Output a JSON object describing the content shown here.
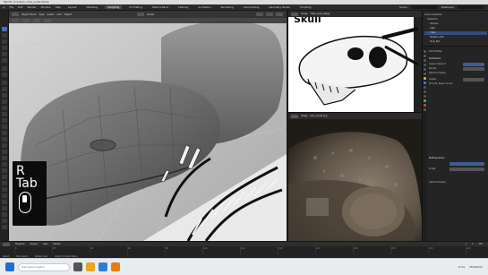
{
  "window": {
    "title": "Blender [C:\\Users\\…\\trex_sculpt.blend]"
  },
  "menubar": {
    "items": [
      "File",
      "Edit",
      "Render",
      "Window",
      "Help"
    ],
    "workspaces": [
      "Layout",
      "Modeling",
      "Sculpting",
      "UV Editing",
      "Texture Paint",
      "Shading",
      "Animation",
      "Rendering",
      "Compositing",
      "Geometry Nodes",
      "Scripting"
    ],
    "active_workspace": "Sculpting",
    "scene_label": "Scene",
    "view_layer_label": "ViewLayer"
  },
  "viewport": {
    "mode_label": "Object Mode",
    "menu": [
      "View",
      "Select",
      "Add",
      "Object"
    ],
    "shading_label": "Global"
  },
  "key_overlay": {
    "line1": "R",
    "line2": "Tab"
  },
  "image_viewer": {
    "header_label": "Image",
    "image_name": "T-Rex_skull_ref.jpg",
    "heading": "Skull"
  },
  "render_viewer": {
    "header_label": "Image",
    "image_name": "trex_render.png"
  },
  "outliner": {
    "rows": [
      "Scene Collection",
      "Collection",
      "Camera",
      "Light",
      "T-Rex",
      "Skeleton_Ref",
      "Skull_Ref"
    ],
    "selected_index": 4
  },
  "properties": {
    "tabs": [
      "tool",
      "render",
      "output",
      "view-layer",
      "scene",
      "world",
      "object",
      "modifiers",
      "particles",
      "physics",
      "constraints",
      "data",
      "material",
      "texture"
    ],
    "rows": [
      {
        "label": "Add Modifier",
        "value": ""
      },
      {
        "label": "Subdivision",
        "value": ""
      },
      {
        "label": "Levels Viewport",
        "value": "2"
      },
      {
        "label": "Render",
        "value": "2"
      },
      {
        "label": "Optimal Display",
        "value": ""
      },
      {
        "label": "Quality",
        "value": "3"
      },
      {
        "label": "Smooth, Keep Corners",
        "value": ""
      },
      {
        "label": "Multiresolution",
        "value": ""
      },
      {
        "label": "Sculpt",
        "value": ""
      },
      {
        "label": "Optimal Display",
        "value": ""
      }
    ]
  },
  "timeline": {
    "menu": [
      "Playback",
      "Keying",
      "View",
      "Marker"
    ],
    "start": "1",
    "end": "250",
    "current": "1",
    "ticks": [
      "0",
      "20",
      "40",
      "60",
      "80",
      "100",
      "120",
      "140",
      "160",
      "180",
      "200",
      "220",
      "240"
    ]
  },
  "statusbar": {
    "items": [
      "Select",
      "Box Select",
      "Rotate View",
      "Object Context Menu"
    ]
  },
  "taskbar": {
    "search_placeholder": "Type here to search",
    "time": "12:24",
    "date": "05/06/2021"
  },
  "colors": {
    "accent_blue": "#4b7ad1",
    "selected_row": "#334d80"
  }
}
